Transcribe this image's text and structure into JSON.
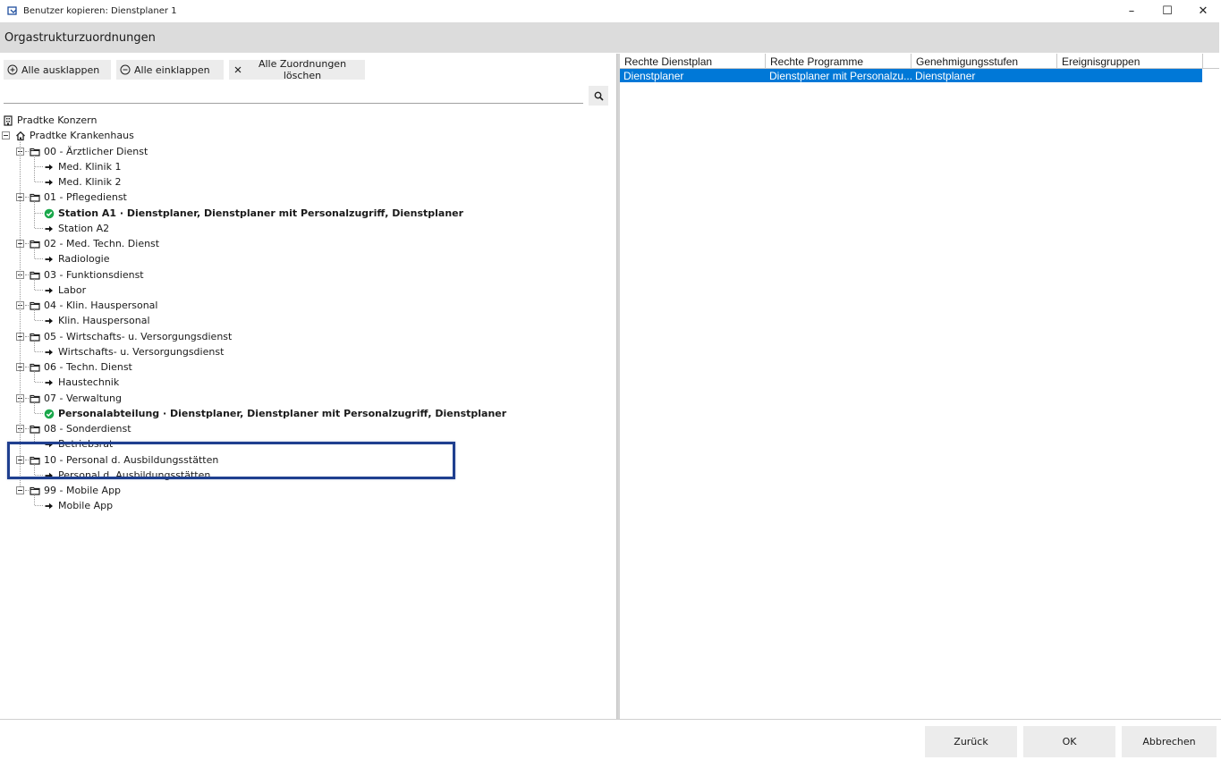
{
  "window": {
    "title": "Benutzer kopieren: Dienstplaner 1",
    "minimize_glyph": "–",
    "maximize_glyph": "☐",
    "close_glyph": "✕"
  },
  "section": {
    "title": "Orgastrukturzuordnungen"
  },
  "toolbar": {
    "expand_all": "Alle ausklappen",
    "collapse_all": "Alle einklappen",
    "clear_all": "Alle Zuordnungen löschen"
  },
  "search": {
    "value": "",
    "placeholder": ""
  },
  "tree": {
    "root": "Pradtke Konzern",
    "hospital": "Pradtke Krankenhaus",
    "groups": [
      {
        "label": "00 - Ärztlicher Dienst",
        "children": [
          {
            "label": "Med. Klinik 1",
            "assigned": false
          },
          {
            "label": "Med. Klinik 2",
            "assigned": false
          }
        ]
      },
      {
        "label": "01 - Pflegedienst",
        "children": [
          {
            "label": "Station A1 · Dienstplaner, Dienstplaner mit Personalzugriff, Dienstplaner",
            "assigned": true
          },
          {
            "label": "Station A2",
            "assigned": false
          }
        ]
      },
      {
        "label": "02 - Med. Techn. Dienst",
        "children": [
          {
            "label": "Radiologie",
            "assigned": false
          }
        ]
      },
      {
        "label": "03 - Funktionsdienst",
        "children": [
          {
            "label": "Labor",
            "assigned": false
          }
        ]
      },
      {
        "label": "04 - Klin. Hauspersonal",
        "children": [
          {
            "label": "Klin. Hauspersonal",
            "assigned": false
          }
        ]
      },
      {
        "label": "05 - Wirtschafts- u. Versorgungsdienst",
        "children": [
          {
            "label": "Wirtschafts- u. Versorgungsdienst",
            "assigned": false
          }
        ]
      },
      {
        "label": "06 - Techn. Dienst",
        "children": [
          {
            "label": "Haustechnik",
            "assigned": false
          }
        ]
      },
      {
        "label": "07 - Verwaltung",
        "children": [
          {
            "label": "Personalabteilung · Dienstplaner, Dienstplaner mit Personalzugriff, Dienstplaner",
            "assigned": true
          }
        ]
      },
      {
        "label": "08 - Sonderdienst",
        "children": [
          {
            "label": "Betriebsrat",
            "assigned": false
          }
        ]
      },
      {
        "label": "10 - Personal d. Ausbildungsstätten",
        "children": [
          {
            "label": "Personal d. Ausbildungsstätten",
            "assigned": false
          }
        ]
      },
      {
        "label": "99 - Mobile App",
        "children": [
          {
            "label": "Mobile App",
            "assigned": false
          }
        ]
      }
    ]
  },
  "grid": {
    "columns": [
      "Rechte Dienstplan",
      "Rechte Programme",
      "Genehmigungsstufen",
      "Ereignisgruppen"
    ],
    "rows": [
      [
        "Dienstplaner",
        "Dienstplaner mit Personalzu...",
        "Dienstplaner",
        ""
      ]
    ]
  },
  "footer": {
    "back": "Zurück",
    "ok": "OK",
    "cancel": "Abbrechen"
  },
  "colors": {
    "accent": "#0078d7",
    "highlight_border": "#1f3f8f",
    "assigned_check": "#1aa84b",
    "header_bg": "#dcdcdc"
  }
}
